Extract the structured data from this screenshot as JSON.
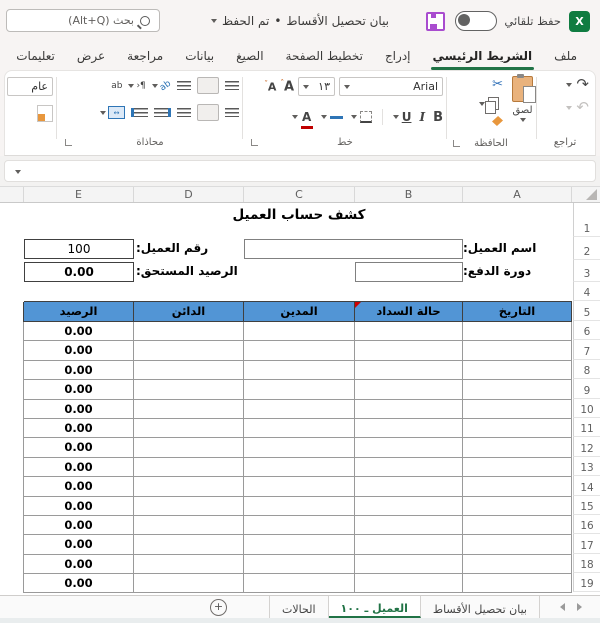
{
  "titlebar": {
    "app": "Excel",
    "autosave_label": "حفظ تلقائي",
    "doc_title": "بيان تحصيل الأقساط",
    "separator": "•",
    "saved_status": "تم الحفظ",
    "search_placeholder": "بحث (Alt+Q)"
  },
  "ribbon_tabs": [
    {
      "label": "ملف",
      "cls": ""
    },
    {
      "label": "الشريط الرئيسي",
      "cls": "active"
    },
    {
      "label": "إدراج",
      "cls": ""
    },
    {
      "label": "تخطيط الصفحة",
      "cls": ""
    },
    {
      "label": "الصيغ",
      "cls": ""
    },
    {
      "label": "بيانات",
      "cls": ""
    },
    {
      "label": "مراجعة",
      "cls": ""
    },
    {
      "label": "عرض",
      "cls": ""
    },
    {
      "label": "تعليمات",
      "cls": ""
    }
  ],
  "ribbon": {
    "undo_group": "تراجع",
    "clipboard_group": "الحافظة",
    "paste_label": "لصق",
    "font_group": "خط",
    "font_name": "Arial",
    "font_size": "١٣",
    "bold": "B",
    "italic": "I",
    "underline": "U",
    "grow_font": "A",
    "shrink_font": "A",
    "font_color": "A",
    "align_group": "محاذاة",
    "wrap_text": "ab",
    "orientation": "ab",
    "number_format": "عام"
  },
  "columns": [
    {
      "label": "E"
    },
    {
      "label": "D"
    },
    {
      "label": "C"
    },
    {
      "label": "B"
    },
    {
      "label": "A"
    }
  ],
  "rows": [
    {
      "n": "1",
      "h": "34"
    },
    {
      "n": "2",
      "h": "23"
    },
    {
      "n": "3",
      "h": "22"
    },
    {
      "n": "4",
      "h": "19"
    },
    {
      "n": "5",
      "h": "20"
    },
    {
      "n": "6",
      "h": "19.4"
    },
    {
      "n": "7",
      "h": "19.4"
    },
    {
      "n": "8",
      "h": "19.4"
    },
    {
      "n": "9",
      "h": "19.4"
    },
    {
      "n": "10",
      "h": "19.4"
    },
    {
      "n": "11",
      "h": "19.4"
    },
    {
      "n": "12",
      "h": "19.4"
    },
    {
      "n": "13",
      "h": "19.4"
    },
    {
      "n": "14",
      "h": "19.4"
    },
    {
      "n": "15",
      "h": "19.4"
    },
    {
      "n": "16",
      "h": "19.4"
    },
    {
      "n": "17",
      "h": "19.4"
    },
    {
      "n": "18",
      "h": "19.4"
    },
    {
      "n": "19",
      "h": "19.4"
    }
  ],
  "sheet": {
    "title": "كشف حساب العميل",
    "customer_name_label": "اسم العميل:",
    "customer_no_label": "رقم العميل:",
    "customer_no_value": "100",
    "pay_cycle_label": "دورة الدفع:",
    "balance_due_label": "الرصيد المستحق:",
    "balance_due_value": "0.00"
  },
  "table": {
    "headers": {
      "date": "التاريخ",
      "status": "حالة السداد",
      "debit": "المدين",
      "credit": "الدائن",
      "balance": "الرصيد"
    },
    "body": [
      {
        "balance": "0.00"
      },
      {
        "balance": "0.00"
      },
      {
        "balance": "0.00"
      },
      {
        "balance": "0.00"
      },
      {
        "balance": "0.00"
      },
      {
        "balance": "0.00"
      },
      {
        "balance": "0.00"
      },
      {
        "balance": "0.00"
      },
      {
        "balance": "0.00"
      },
      {
        "balance": "0.00"
      },
      {
        "balance": "0.00"
      },
      {
        "balance": "0.00"
      },
      {
        "balance": "0.00"
      },
      {
        "balance": "0.00"
      }
    ]
  },
  "sheet_tabs": [
    {
      "label": "بيان تحصيل الأقساط",
      "cls": ""
    },
    {
      "label": "العميل ـ ١٠٠",
      "cls": "active"
    },
    {
      "label": "الحالات",
      "cls": ""
    }
  ],
  "colors": {
    "excel_green": "#217346",
    "header_blue": "#5295d5",
    "save_purple": "#a94ccf",
    "flag_red": "#d00000"
  }
}
